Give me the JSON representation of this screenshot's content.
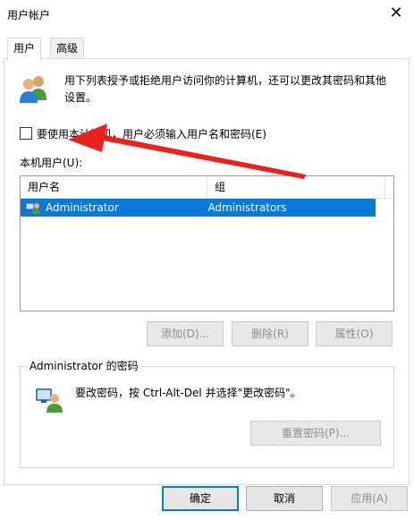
{
  "window": {
    "title": "用户帐户",
    "close_glyph": "✕"
  },
  "tabs": [
    {
      "label": "用户",
      "active": true
    },
    {
      "label": "高级",
      "active": false
    }
  ],
  "intro": {
    "text": "用下列表授予或拒绝用户访问你的计算机，还可以更改其密码和其他设置。"
  },
  "checkbox": {
    "label": "要使用本计算机，用户必须输入用户名和密码(E)",
    "checked": false
  },
  "users_section": {
    "label": "本机用户(U):",
    "columns": [
      "用户名",
      "组"
    ],
    "rows": [
      {
        "username": "Administrator",
        "group": "Administrators",
        "selected": true
      }
    ]
  },
  "list_buttons": {
    "add": "添加(D)...",
    "remove": "删除(R)",
    "properties": "属性(O)"
  },
  "password_group": {
    "title": "Administrator 的密码",
    "text": "要改密码，按 Ctrl-Alt-Del 并选择\"更改密码\"。",
    "reset_button": "重置密码(P)..."
  },
  "dialog_buttons": {
    "ok": "确定",
    "cancel": "取消",
    "apply": "应用(A)"
  },
  "colors": {
    "selection": "#0a78d7",
    "annotation_arrow": "#e8231f"
  }
}
